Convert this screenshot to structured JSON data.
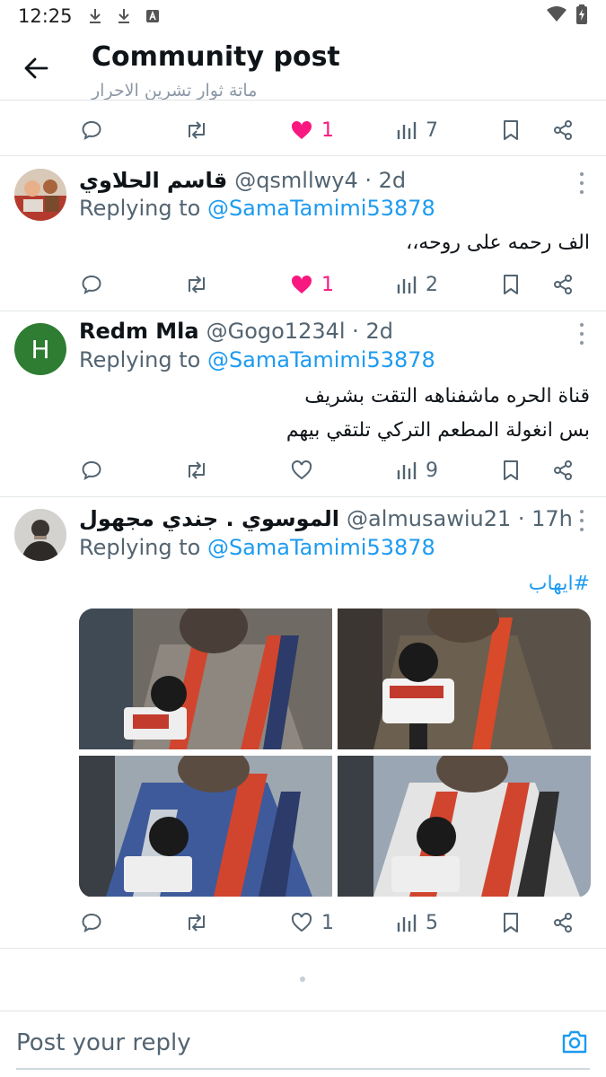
{
  "status_bar": {
    "time": "12:25"
  },
  "header": {
    "title": "Community post",
    "subtitle": "ماتة ثوار تشرين الاحرار"
  },
  "top_actions": {
    "likes": "1",
    "views": "7"
  },
  "posts": [
    {
      "author": "قاسم الحلاوي",
      "handle": "@qsmllwy4 · 2d",
      "replying_prefix": "Replying to ",
      "replying_to": "@SamaTamimi53878",
      "text_lines": [
        "الف رحمه على روحه،،"
      ],
      "likes": "1",
      "views": "2"
    },
    {
      "author": "Redm Mla",
      "handle": "@Gogo1234l · 2d",
      "avatar_letter": "H",
      "replying_prefix": "Replying to ",
      "replying_to": "@SamaTamimi53878",
      "text_lines": [
        "قناة الحره ماشفناهه التقت بشريف",
        "بس انغولة المطعم التركي تلتقي بيهم"
      ],
      "likes": "",
      "views": "9"
    },
    {
      "author": "الموسوي . جندي مجهول",
      "handle": "@almusawiu21 · 17h",
      "replying_prefix": "Replying to ",
      "replying_to": "@SamaTamimi53878",
      "hashtag": "#ايهاب",
      "likes": "1",
      "views": "5"
    }
  ],
  "reply_bar": {
    "placeholder": "Post your reply"
  },
  "colors": {
    "accent": "#1d9bf0",
    "like": "#f91880",
    "icon": "#536471",
    "divider": "#e1e6ea"
  }
}
